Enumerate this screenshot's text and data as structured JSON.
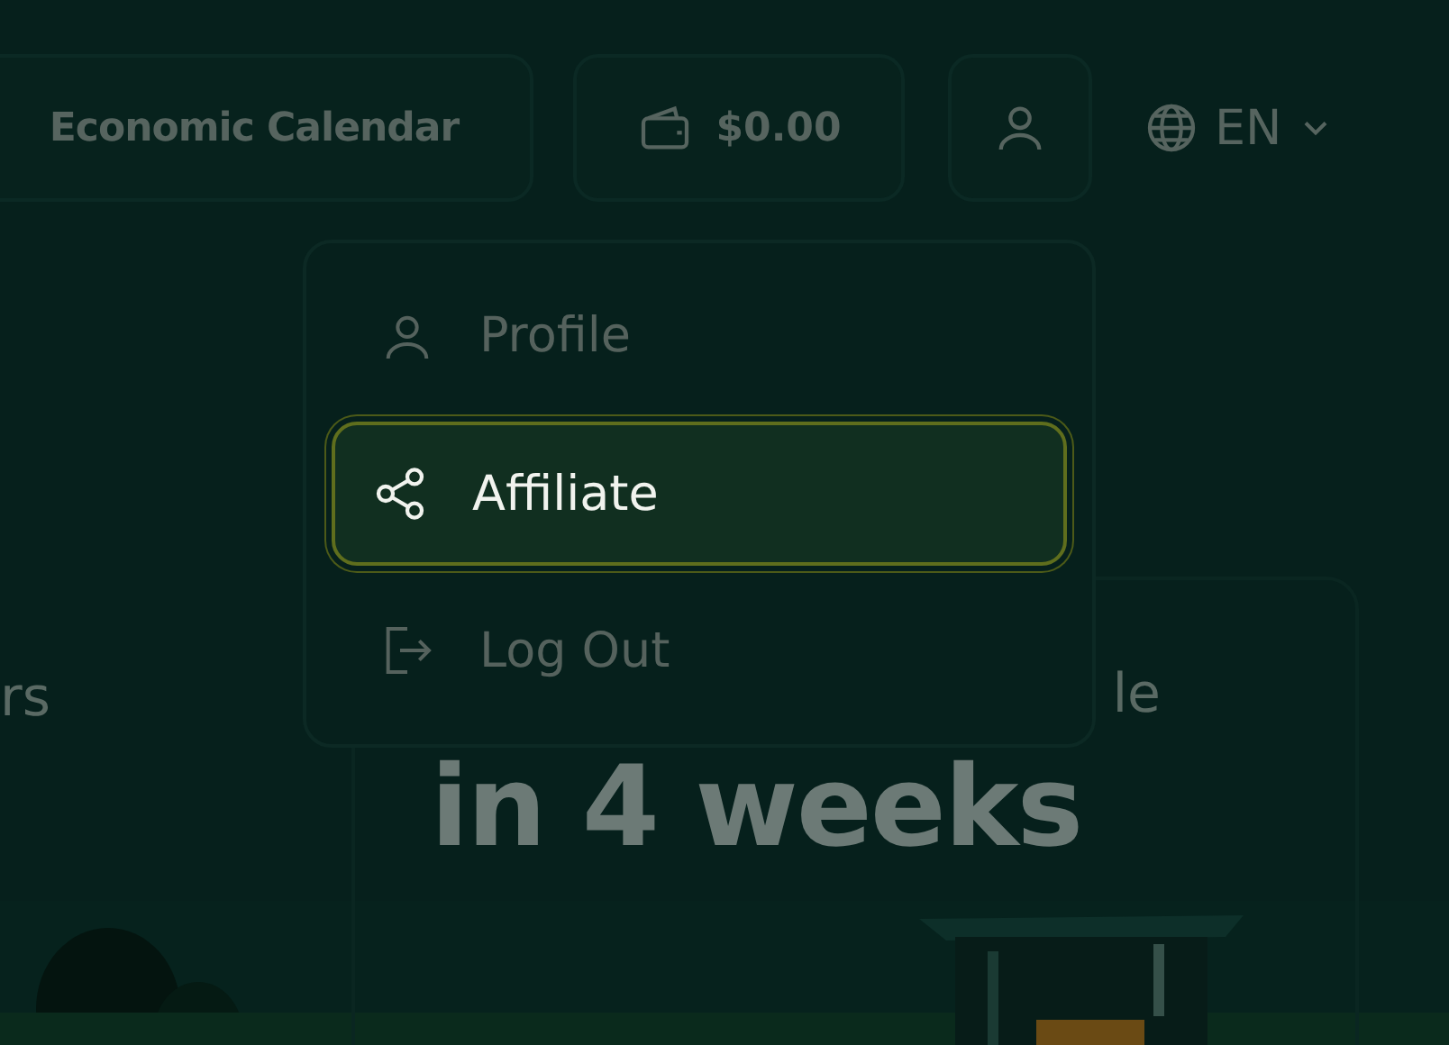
{
  "header": {
    "calendar_button": "Economic Calendar",
    "balance": "$0.00",
    "language": "EN"
  },
  "user_menu": {
    "items": [
      {
        "kind": "profile",
        "label": "Profile",
        "selected": false
      },
      {
        "kind": "share",
        "label": "Affiliate",
        "selected": true
      },
      {
        "kind": "logout",
        "label": "Log Out",
        "selected": false
      }
    ]
  },
  "background": {
    "left_text": "rs",
    "card": {
      "corner_text": "le",
      "headline": "in 4 weeks"
    }
  }
}
